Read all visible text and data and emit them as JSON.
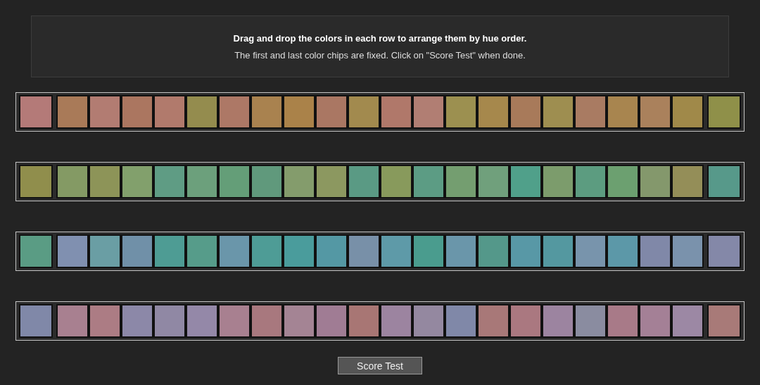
{
  "instructions": {
    "title": "Drag and drop the colors in each row to arrange them by hue order.",
    "text": "The first and last color chips are fixed. Click on \"Score Test\" when done."
  },
  "rows": [
    {
      "first": {
        "color": "#b47a78"
      },
      "chips": [
        {
          "color": "#a97a58"
        },
        {
          "color": "#b27c72"
        },
        {
          "color": "#ab7660"
        },
        {
          "color": "#b17a6c"
        },
        {
          "color": "#948c4e"
        },
        {
          "color": "#ad7866"
        },
        {
          "color": "#a9824f"
        },
        {
          "color": "#aa8249"
        },
        {
          "color": "#aa7763"
        },
        {
          "color": "#a28a4e"
        },
        {
          "color": "#b0786a"
        },
        {
          "color": "#b17e73"
        },
        {
          "color": "#9c9050"
        },
        {
          "color": "#a6884c"
        },
        {
          "color": "#a87a5a"
        },
        {
          "color": "#9e8e50"
        },
        {
          "color": "#a97b62"
        },
        {
          "color": "#a8854f"
        },
        {
          "color": "#aa815c"
        },
        {
          "color": "#a08949"
        }
      ],
      "last": {
        "color": "#8f9049"
      }
    },
    {
      "first": {
        "color": "#908e4c"
      },
      "chips": [
        {
          "color": "#849a64"
        },
        {
          "color": "#8d9458"
        },
        {
          "color": "#82a06c"
        },
        {
          "color": "#5f9c84"
        },
        {
          "color": "#6ca07c"
        },
        {
          "color": "#649e78"
        },
        {
          "color": "#60997c"
        },
        {
          "color": "#849c6c"
        },
        {
          "color": "#8c9860"
        },
        {
          "color": "#5a9a84"
        },
        {
          "color": "#889a5c"
        },
        {
          "color": "#5c9c84"
        },
        {
          "color": "#749e70"
        },
        {
          "color": "#70a07c"
        },
        {
          "color": "#50a08a"
        },
        {
          "color": "#7c9c6c"
        },
        {
          "color": "#5c9c80"
        },
        {
          "color": "#6ca070"
        },
        {
          "color": "#84986c"
        },
        {
          "color": "#948e58"
        }
      ],
      "last": {
        "color": "#57998a"
      }
    },
    {
      "first": {
        "color": "#5a9c84"
      },
      "chips": [
        {
          "color": "#8090b0"
        },
        {
          "color": "#6a9ea4"
        },
        {
          "color": "#7090a8"
        },
        {
          "color": "#4e9c94"
        },
        {
          "color": "#569c8a"
        },
        {
          "color": "#6a96aa"
        },
        {
          "color": "#4e9c96"
        },
        {
          "color": "#4a9c9c"
        },
        {
          "color": "#5498a4"
        },
        {
          "color": "#7890a8"
        },
        {
          "color": "#5e9aa8"
        },
        {
          "color": "#4a9c8e"
        },
        {
          "color": "#6a96aa"
        },
        {
          "color": "#54988a"
        },
        {
          "color": "#5898a6"
        },
        {
          "color": "#5498a0"
        },
        {
          "color": "#7894ac"
        },
        {
          "color": "#5c98a8"
        },
        {
          "color": "#8088a8"
        },
        {
          "color": "#7a92ac"
        }
      ],
      "last": {
        "color": "#8488a8"
      }
    },
    {
      "first": {
        "color": "#8088a8"
      },
      "chips": [
        {
          "color": "#a88090"
        },
        {
          "color": "#ac7c84"
        },
        {
          "color": "#8c88a8"
        },
        {
          "color": "#9088a4"
        },
        {
          "color": "#9488a8"
        },
        {
          "color": "#a88090"
        },
        {
          "color": "#a8787e"
        },
        {
          "color": "#a48494"
        },
        {
          "color": "#a07c94"
        },
        {
          "color": "#a87674"
        },
        {
          "color": "#9c84a0"
        },
        {
          "color": "#9488a0"
        },
        {
          "color": "#8088a8"
        },
        {
          "color": "#a87878"
        },
        {
          "color": "#aa7880"
        },
        {
          "color": "#9c84a0"
        },
        {
          "color": "#8a8ca0"
        },
        {
          "color": "#a87a88"
        },
        {
          "color": "#a48096"
        },
        {
          "color": "#9c88a4"
        }
      ],
      "last": {
        "color": "#a87a78"
      }
    }
  ],
  "button": {
    "label": "Score Test"
  }
}
